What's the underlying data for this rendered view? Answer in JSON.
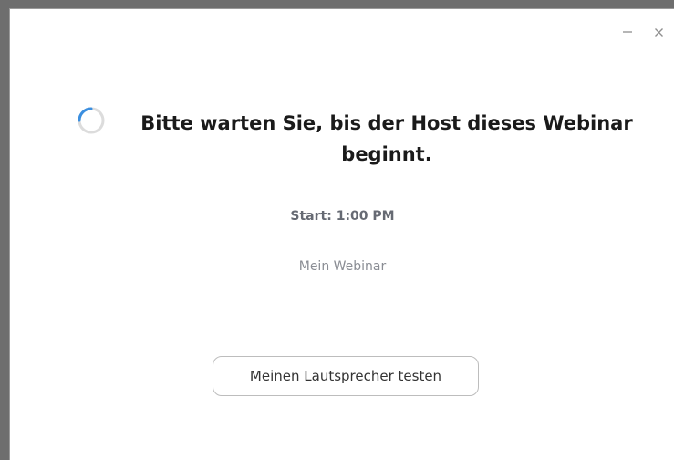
{
  "window": {
    "controls": {
      "minimize_icon": "minimize-icon",
      "close_icon": "close-icon"
    }
  },
  "main": {
    "spinner_icon": "loading-spinner-icon",
    "title_line1": "Bitte warten Sie, bis der Host dieses Webinar",
    "title_line2": "beginnt.",
    "start_time": "Start: 1:00 PM",
    "webinar_name": "Mein Webinar",
    "test_speaker_label": "Meinen Lautsprecher testen"
  },
  "colors": {
    "spinner_accent": "#3b8fe0",
    "spinner_track": "#dcdcdc"
  }
}
